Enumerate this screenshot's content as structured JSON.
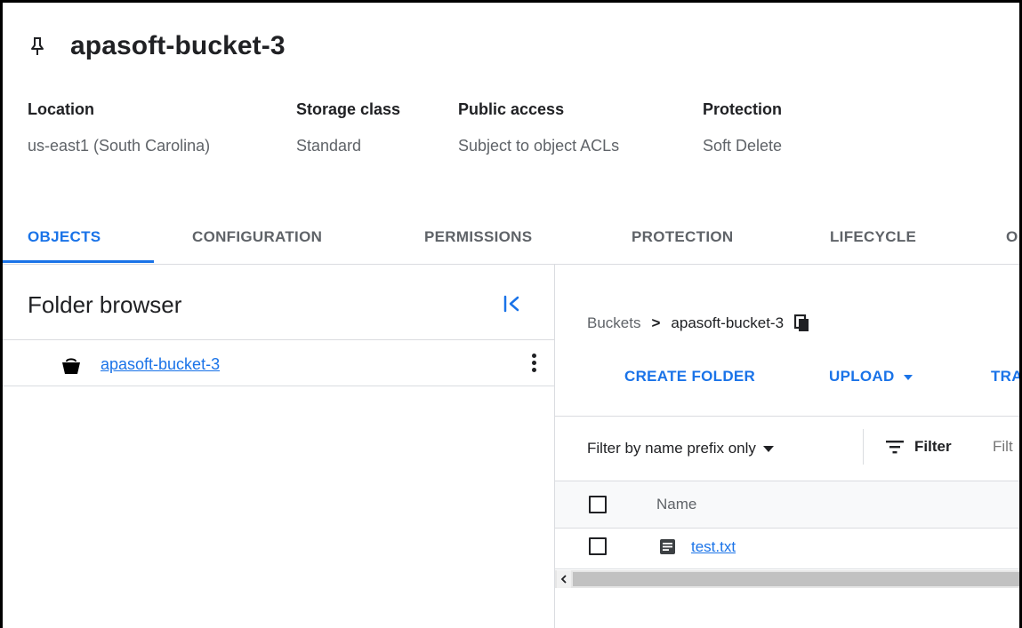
{
  "header": {
    "title": "apasoft-bucket-3",
    "pin_icon": "pin-icon"
  },
  "metadata": [
    {
      "label": "Location",
      "value": "us-east1 (South Carolina)"
    },
    {
      "label": "Storage class",
      "value": "Standard"
    },
    {
      "label": "Public access",
      "value": "Subject to object ACLs"
    },
    {
      "label": "Protection",
      "value": "Soft Delete"
    }
  ],
  "tabs": [
    {
      "label": "OBJECTS",
      "active": true
    },
    {
      "label": "CONFIGURATION",
      "active": false
    },
    {
      "label": "PERMISSIONS",
      "active": false
    },
    {
      "label": "PROTECTION",
      "active": false
    },
    {
      "label": "LIFECYCLE",
      "active": false
    },
    {
      "label": "O",
      "active": false
    }
  ],
  "folder_browser": {
    "title": "Folder browser",
    "collapse_icon": "collapse-left-icon",
    "items": [
      {
        "label": "apasoft-bucket-3",
        "icon": "bucket-icon",
        "menu_icon": "more-vert-icon"
      }
    ]
  },
  "breadcrumb": {
    "root": "Buckets",
    "separator": ">",
    "current": "apasoft-bucket-3",
    "copy_icon": "copy-icon"
  },
  "actions": {
    "create_folder": "CREATE FOLDER",
    "upload": "UPLOAD",
    "transfer": "TRA"
  },
  "filter": {
    "prefix_label": "Filter by name prefix only",
    "filter_label": "Filter",
    "filter_placeholder": "Filt"
  },
  "table": {
    "columns": [
      "Name"
    ],
    "rows": [
      {
        "name": "test.txt",
        "icon": "text-file-icon"
      }
    ]
  },
  "colors": {
    "accent": "#1a73e8",
    "text": "#202124",
    "secondary_text": "#5f6368",
    "divider": "#dadce0"
  }
}
